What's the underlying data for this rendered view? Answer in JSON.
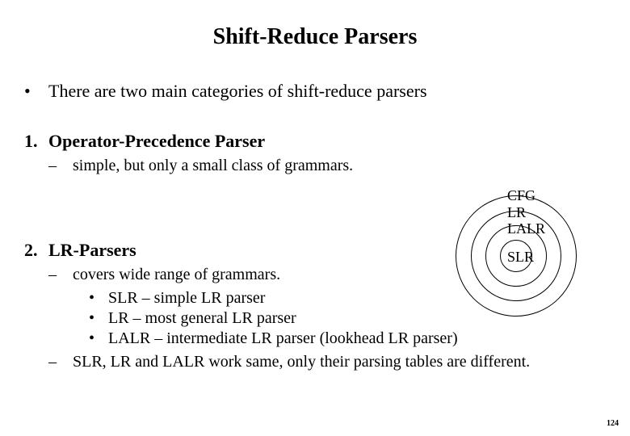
{
  "title": "Shift-Reduce Parsers",
  "intro": {
    "bullet": "•",
    "text": "There are two main categories of shift-reduce parsers"
  },
  "item1": {
    "num": "1.",
    "heading": "Operator-Precedence Parser",
    "sub": {
      "dash": "–",
      "text": "simple, but only a small class of grammars."
    }
  },
  "item2": {
    "num": "2.",
    "heading": "LR-Parsers",
    "sub1": {
      "dash": "–",
      "text": "covers wide range of grammars."
    },
    "sub1a": {
      "bullet": "•",
      "text": "SLR – simple LR parser"
    },
    "sub1b": {
      "bullet": "•",
      "text": "LR – most general LR parser"
    },
    "sub1c": {
      "bullet": "•",
      "text": "LALR – intermediate LR parser (lookhead LR parser)"
    },
    "sub2": {
      "dash": "–",
      "text": "SLR, LR and LALR work same, only their parsing tables are different."
    }
  },
  "diagram": {
    "label1": "CFG",
    "label2": "LR",
    "label3": "LALR",
    "label4": "SLR"
  },
  "page": "124"
}
